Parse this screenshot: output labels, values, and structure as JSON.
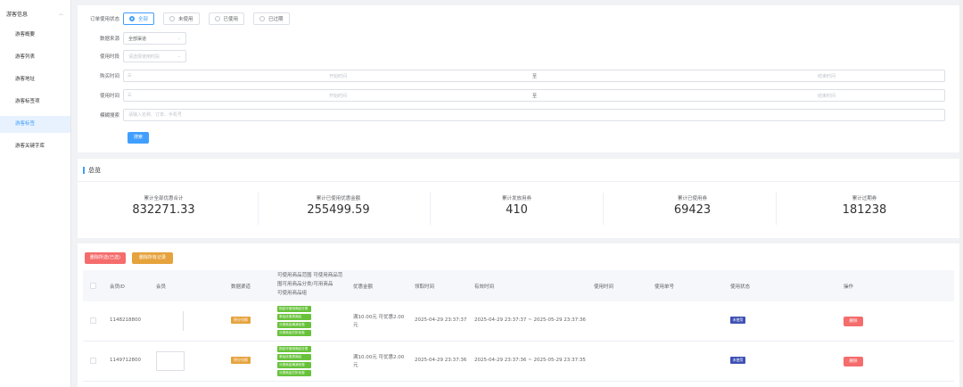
{
  "sidebar": {
    "group_label": "游客信息",
    "items": [
      {
        "label": "游客概要"
      },
      {
        "label": "游客列表"
      },
      {
        "label": "游客地址"
      },
      {
        "label": "游客标签项"
      },
      {
        "label": "游客标签"
      },
      {
        "label": "游客关键字库"
      }
    ],
    "active_index": 4
  },
  "filter": {
    "status_label": "订单使用状态",
    "status_options": [
      {
        "label": "全部",
        "selected": true
      },
      {
        "label": "未使用",
        "selected": false
      },
      {
        "label": "已使用",
        "selected": false
      },
      {
        "label": "已过期",
        "selected": false
      }
    ],
    "source_label": "数据来源",
    "source_value": "全部渠道",
    "period_label": "使用时段",
    "period_placeholder": "请选择使用时段",
    "purchase_label": "购买时间",
    "purchase_start": "开始时间",
    "purchase_sep": "至",
    "purchase_end": "结束时间",
    "use_label": "使用时间",
    "use_start": "开始时间",
    "use_sep": "至",
    "use_end": "结束时间",
    "keyword_label": "模糊搜索",
    "keyword_placeholder": "请输入名称、订单、手机号",
    "search_button": "搜索"
  },
  "summary": {
    "title": "总览",
    "stats": [
      {
        "label": "累计全部优惠合计",
        "value": "832271.33"
      },
      {
        "label": "累计已使用优惠金额",
        "value": "255499.59"
      },
      {
        "label": "累计发放用券",
        "value": "410"
      },
      {
        "label": "累计已使用券",
        "value": "69423"
      },
      {
        "label": "累计过期券",
        "value": "181238"
      }
    ]
  },
  "table": {
    "btn_export_selected": "删除所选(已选)",
    "btn_export_all": "删除所有记录",
    "headers": {
      "id": "会员ID",
      "member": "会员",
      "channel": "数据渠道",
      "scope_l1": "可使用商品范围 可使用商品范",
      "scope_l2": "围可用商品分类/可用商品",
      "scope_l3": "可使用商品组",
      "amount": "优惠金额",
      "receive_time": "领取时间",
      "valid_period": "有效时间",
      "use_time": "使用时间",
      "order_no": "使用单号",
      "status": "使用状态",
      "action": "操作"
    },
    "rows": [
      {
        "id": "1148218800",
        "channel_tag": "积分兑换",
        "scope_tags": [
          "指定可使用商品分类",
          "单品优惠类商品",
          "分类商品满减优惠",
          "分类商品打折优惠"
        ],
        "amount": "满10.00元 可优惠2.00元",
        "receive_time": "2025-04-29 23:37:37",
        "valid_period": "2025-04-29 23:37:37 ~ 2025-05-29 23:37:36",
        "status_tag": "未使用",
        "action": "删除"
      },
      {
        "id": "1149712800",
        "channel_tag": "积分兑换",
        "scope_tags": [
          "指定可使用商品分类",
          "单品优惠类商品",
          "分类商品满减优惠",
          "分类商品打折优惠"
        ],
        "amount": "满10.00元 可优惠2.00元",
        "receive_time": "2025-04-29 23:37:36",
        "valid_period": "2025-04-29 23:37:36 ~ 2025-05-29 23:37:35",
        "status_tag": "未使用",
        "action": "删除"
      }
    ]
  },
  "colors": {
    "primary": "#409eff",
    "danger": "#f56c6c",
    "warning": "#e6a23c",
    "success": "#67c23a",
    "indigo": "#3f51b5"
  }
}
